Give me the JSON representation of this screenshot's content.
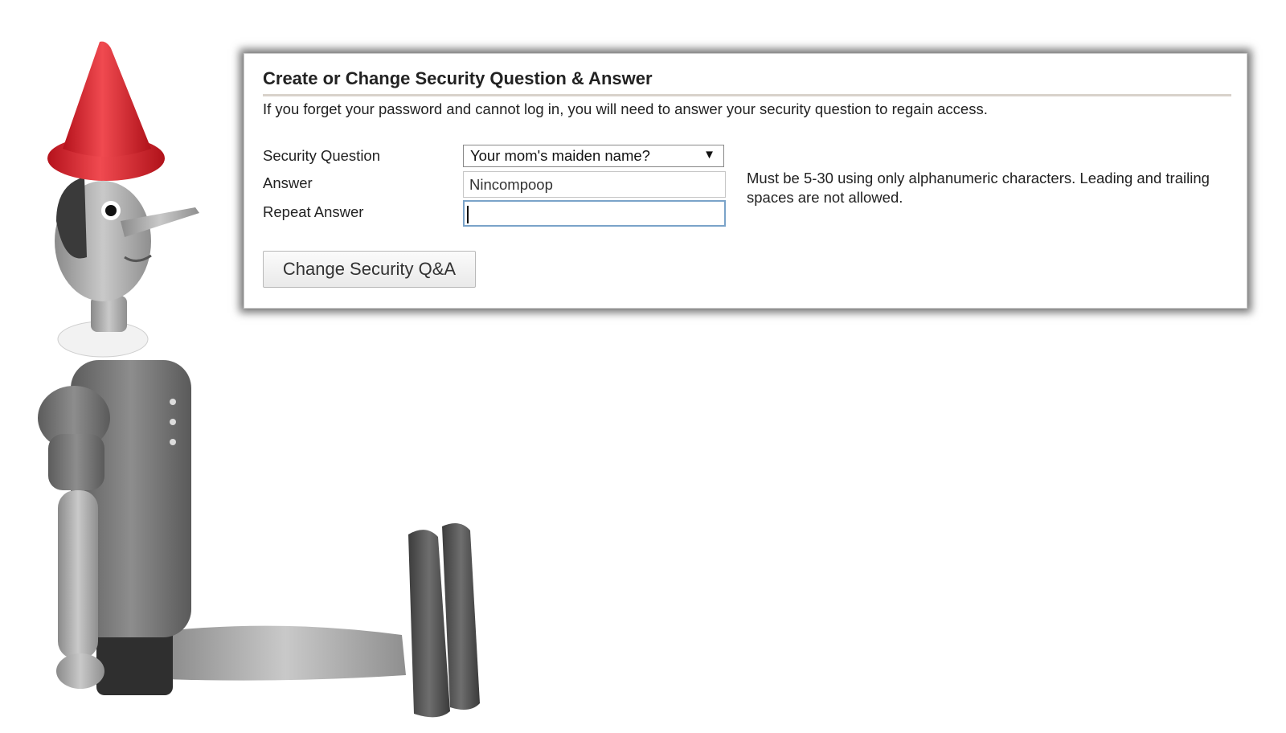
{
  "panel": {
    "title": "Create or Change Security Question & Answer",
    "intro": "If you forget your password and cannot log in, you will need to answer your security question to regain access."
  },
  "form": {
    "question_label": "Security Question",
    "question_value": "Your mom's maiden name?",
    "dropdown_arrow": "▼",
    "answer_label": "Answer",
    "answer_value": "Nincompoop",
    "repeat_label": "Repeat Answer",
    "repeat_value": "",
    "hint": "Must be 5-30 using only alphanumeric characters. Leading and trailing spaces are not allowed.",
    "submit_label": "Change Security Q&A"
  },
  "illustration": {
    "subject": "wooden-puppet-figure",
    "hat_color": "#d81f2a"
  }
}
